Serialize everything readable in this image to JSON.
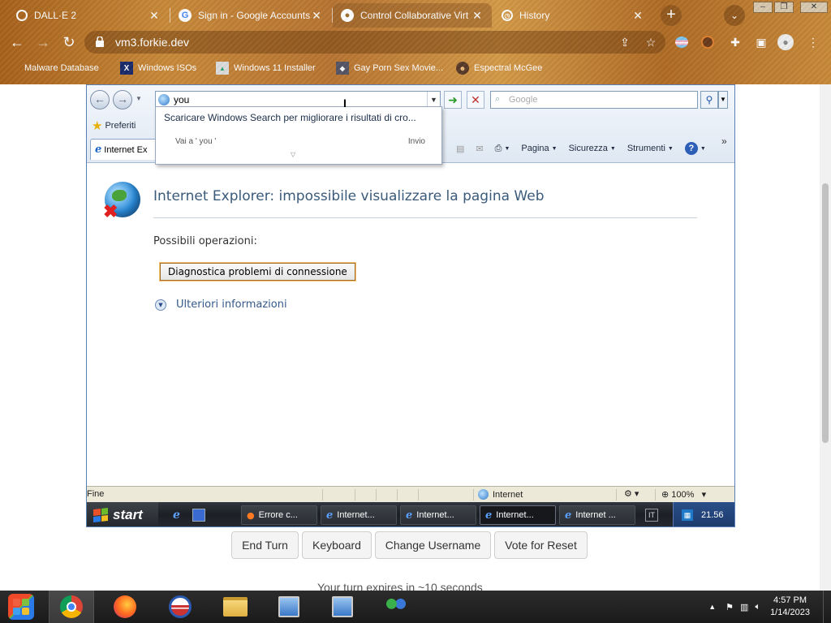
{
  "chrome": {
    "tabs": [
      {
        "title": "DALL·E 2",
        "icon": "openai-icon"
      },
      {
        "title": "Sign in - Google Accounts",
        "icon": "google-icon"
      },
      {
        "title": "Control Collaborative Virt",
        "icon": "globe-icon"
      },
      {
        "title": "History",
        "icon": "history-icon"
      }
    ],
    "url": "vm3.forkie.dev",
    "bookmarks": [
      {
        "label": "Malware Database"
      },
      {
        "label": "Windows ISOs"
      },
      {
        "label": "Windows 11 Installer"
      },
      {
        "label": "Gay Porn Sex Movie..."
      },
      {
        "label": "Espectral McGee"
      }
    ]
  },
  "ie": {
    "address_value": "you",
    "search_placeholder": "Google",
    "suggest": {
      "windows_search": "Scaricare Windows Search per migliorare i risultati di cro...",
      "go_to": "Vai a ' you '",
      "enter": "Invio"
    },
    "favorites_label": "Preferiti",
    "tab_label": "Internet Ex",
    "commands": {
      "page": "Pagina",
      "security": "Sicurezza",
      "tools": "Strumenti"
    },
    "error": {
      "title": "Internet Explorer: impossibile visualizzare la pagina Web",
      "options_label": "Possibili operazioni:",
      "diagnose_button": "Diagnostica problemi di connessione",
      "more_info": "Ulteriori informazioni"
    },
    "status": {
      "text": "Fine",
      "zone": "Internet",
      "zoom": "100%"
    }
  },
  "xp_taskbar": {
    "start_label": "start",
    "tasks": [
      {
        "label": "Errore c...",
        "icon": "firefox-icon",
        "active": false
      },
      {
        "label": "Internet...",
        "icon": "ie-icon",
        "active": false
      },
      {
        "label": "Internet...",
        "icon": "ie-icon",
        "active": false
      },
      {
        "label": "Internet...",
        "icon": "ie-icon",
        "active": true
      },
      {
        "label": "Internet ...",
        "icon": "ie-icon",
        "active": false
      }
    ],
    "lang": "IT",
    "clock": "21.56"
  },
  "controls": {
    "end_turn": "End Turn",
    "keyboard": "Keyboard",
    "change_username": "Change Username",
    "vote_reset": "Vote for Reset",
    "turn_message": "Your turn expires in ~10 seconds"
  },
  "host_taskbar": {
    "time": "4:57 PM",
    "date": "1/14/2023"
  }
}
